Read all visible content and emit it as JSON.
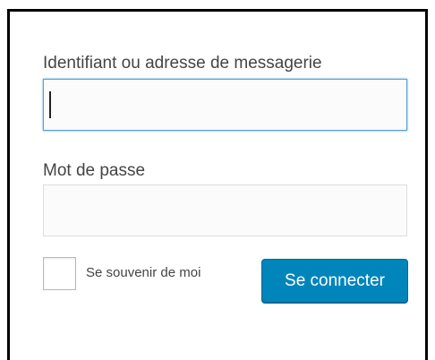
{
  "login_form": {
    "username_label": "Identifiant ou adresse de messagerie",
    "username_value": "",
    "password_label": "Mot de passe",
    "password_value": "",
    "remember_label": "Se souvenir de moi",
    "remember_checked": false,
    "submit_label": "Se connecter"
  },
  "colors": {
    "button_background": "#0085ba",
    "button_text": "#ffffff",
    "focus_border": "#5b9dd9",
    "label_text": "#444444"
  }
}
